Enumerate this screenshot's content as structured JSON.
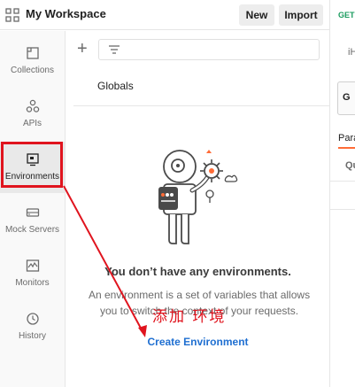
{
  "header": {
    "workspace_title": "My Workspace",
    "new_label": "New",
    "import_label": "Import",
    "workspace_icon": "grid-icon"
  },
  "sidebar": {
    "items": [
      {
        "label": "Collections",
        "icon": "collections-icon"
      },
      {
        "label": "APIs",
        "icon": "apis-icon"
      },
      {
        "label": "Environments",
        "icon": "environments-icon",
        "active": true
      },
      {
        "label": "Mock Servers",
        "icon": "mock-servers-icon"
      },
      {
        "label": "Monitors",
        "icon": "monitors-icon"
      },
      {
        "label": "History",
        "icon": "history-icon"
      }
    ]
  },
  "panel": {
    "add_icon": "plus-icon",
    "filter_icon": "filter-icon",
    "globals_label": "Globals",
    "empty_title": "You don’t have any environments.",
    "empty_desc_line1": "An environment is a set of variables that allows",
    "empty_desc_line2": "you to switch the context of your requests.",
    "create_link": "Create Environment"
  },
  "request_pane": {
    "method": "GET",
    "name_partial": "iH",
    "box_partial": "G",
    "tab_partial": "Para",
    "section_partial": "Qu"
  },
  "annotation": {
    "text": "添加 环境",
    "color": "#e0141e"
  },
  "colors": {
    "accent": "#ff6c37",
    "link": "#1f6fd1",
    "annotation_red": "#e0141e",
    "get_method": "#1a9b5e"
  }
}
